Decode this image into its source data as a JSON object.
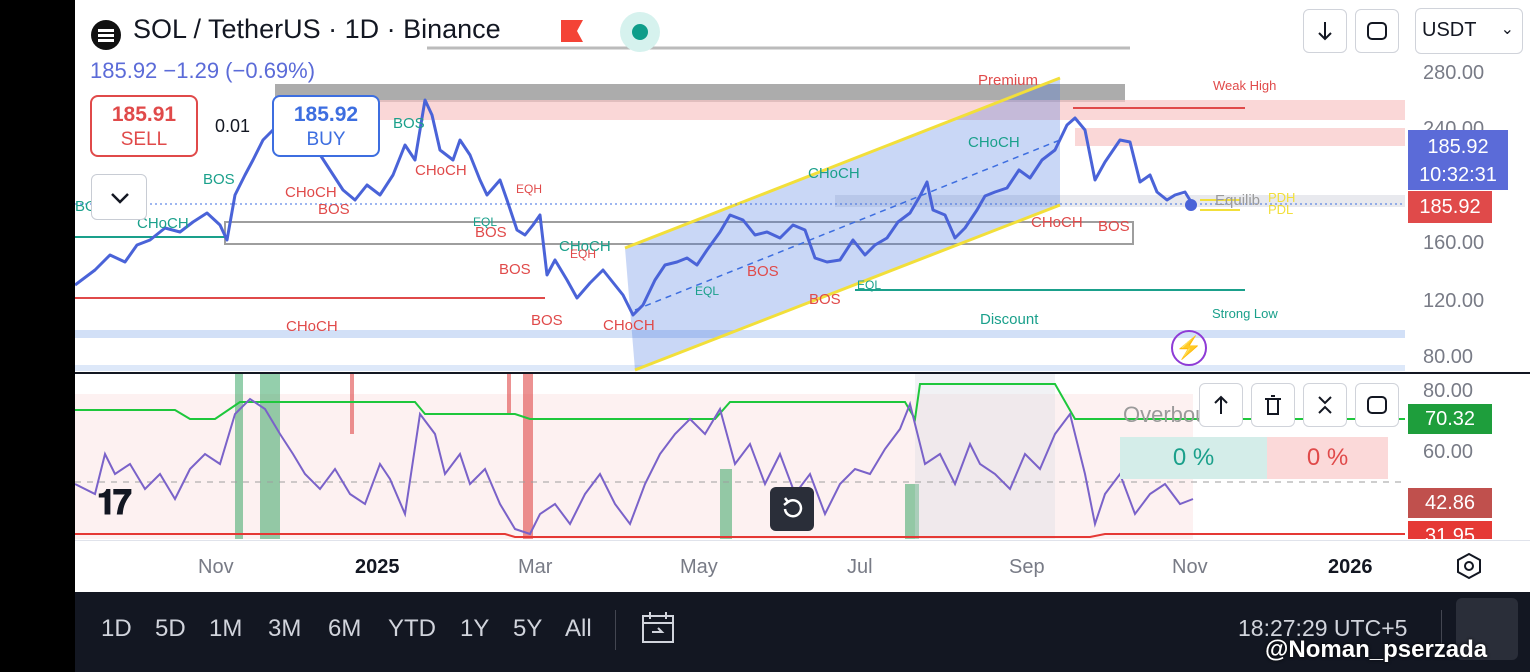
{
  "header": {
    "symbol_title": "SOL / TetherUS · 1D · Binance",
    "price_change": "185.92  −1.29 (−0.69%)",
    "currency": "USDT"
  },
  "trade": {
    "sell_price": "185.91",
    "sell_label": "SELL",
    "buy_price": "185.92",
    "buy_label": "BUY",
    "spread": "0.01"
  },
  "price_axis": [
    "280.00",
    "240.00",
    "160.00",
    "120.00",
    "80.00"
  ],
  "price_tags": {
    "last_price": "185.92",
    "countdown": "10:32:31",
    "bid_price": "185.92"
  },
  "chart_labels": {
    "premium": "Premium",
    "weak_high": "Weak High",
    "equilibrium": "Equilib",
    "pdh": "PDH",
    "pdl": "PDL",
    "discount": "Discount",
    "strong_low": "Strong Low",
    "bos": "BOS",
    "choch": "CHoCH",
    "eqh": "EQH",
    "eql": "EQL"
  },
  "oscillator": {
    "axis": [
      "80.00",
      "60.00"
    ],
    "overbought_text": "Overbought",
    "pct_left": "0 %",
    "pct_right": "0 %",
    "value_upper": "70.32",
    "value_mid": "42.86",
    "value_lower": "31.95",
    "upper_color": "#1e9e3c",
    "mid_color": "#c0504d",
    "lower_color": "#e53935"
  },
  "time_axis": [
    "Nov",
    "2025",
    "Mar",
    "May",
    "Jul",
    "Sep",
    "Nov",
    "2026"
  ],
  "ranges": [
    "1D",
    "5D",
    "1M",
    "3M",
    "6M",
    "YTD",
    "1Y",
    "5Y",
    "All"
  ],
  "clock": "18:27:29 UTC+5",
  "watermark": "@Noman_pserzada",
  "colors": {
    "accent_blue": "#5b6bd8",
    "sell_red": "#e04a4a",
    "buy_blue": "#3d6ee0",
    "bull_teal": "#1aa08b",
    "channel_yellow": "#f2df3a"
  },
  "icons": [
    "solana-coin-icon",
    "flag-icon",
    "live-dot-icon",
    "arrow-down-icon",
    "fullscreen-icon",
    "chevron-down-icon",
    "arrow-up-icon",
    "trash-icon",
    "collapse-icon",
    "settings-hexagon-icon",
    "replay-icon",
    "calendar-goto-icon",
    "lightning-icon",
    "tradingview-logo-icon"
  ]
}
